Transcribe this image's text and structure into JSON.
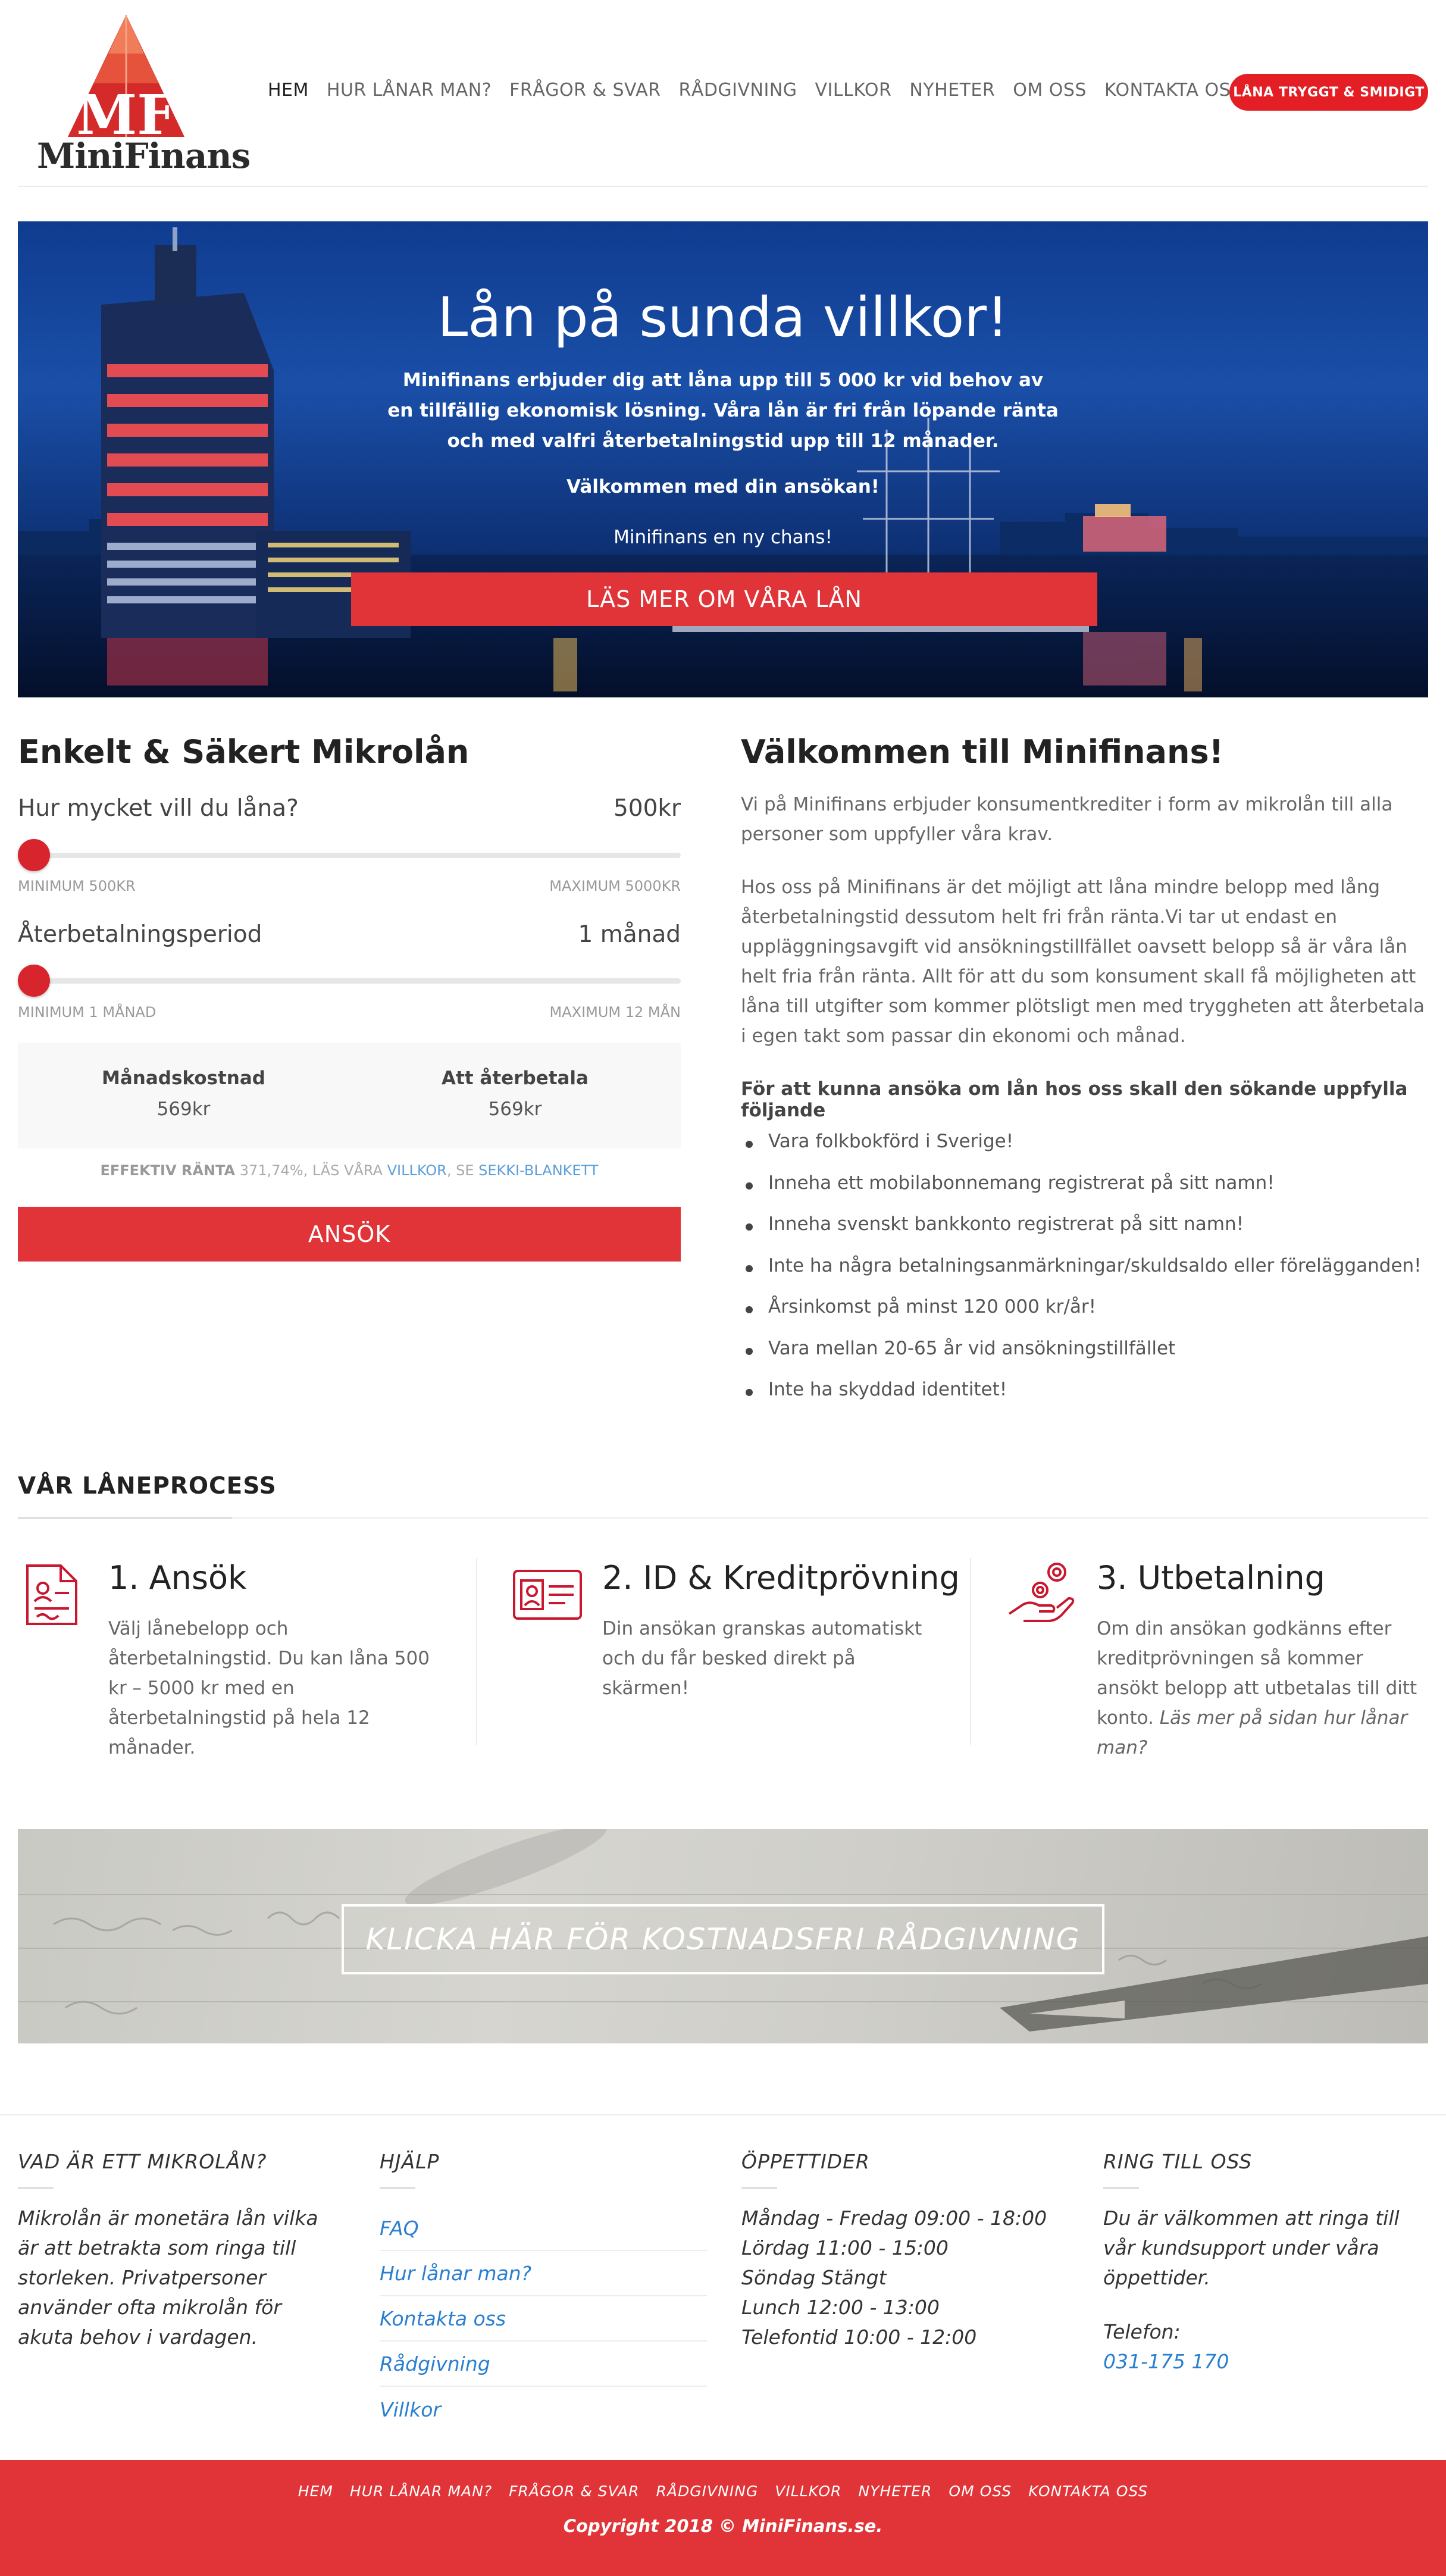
{
  "header": {
    "logo_text": "MiniFinans",
    "logo_monogram": "MF",
    "nav": [
      {
        "label": "HEM",
        "active": true
      },
      {
        "label": "HUR LÅNAR MAN?"
      },
      {
        "label": "FRÅGOR & SVAR"
      },
      {
        "label": "RÅDGIVNING"
      },
      {
        "label": "VILLKOR"
      },
      {
        "label": "NYHETER"
      },
      {
        "label": "OM OSS"
      },
      {
        "label": "KONTAKTA OSS"
      }
    ],
    "cta_label": "LÅNA TRYGGT & SMIDIGT"
  },
  "hero": {
    "title": "Lån på sunda villkor!",
    "text": "Minifinans erbjuder dig att låna upp till 5 000 kr vid behov av en tillfällig ekonomisk lösning. Våra lån är fri från löpande ränta och med valfri återbetalningstid upp till 12 månader.",
    "welcome": "Välkommen med din ansökan!",
    "chance": "Minifinans en ny chans!",
    "button": "LÄS MER OM VÅRA LÅN"
  },
  "calculator": {
    "title": "Enkelt & Säkert Mikrolån",
    "amount_label": "Hur mycket vill du låna?",
    "amount_value": "500kr",
    "amount_min": "MINIMUM 500KR",
    "amount_max": "MAXIMUM 5000KR",
    "amount_fraction": 0.0,
    "period_label": "Återbetalningsperiod",
    "period_value": "1 månad",
    "period_min": "MINIMUM 1 MÅNAD",
    "period_max": "MAXIMUM 12 MÅN",
    "period_fraction": 0.0,
    "monthly_label": "Månadskostnad",
    "monthly_value": "569kr",
    "total_label": "Att återbetala",
    "total_value": "569kr",
    "rate_label": "EFFEKTIV RÄNTA",
    "rate_value": "371,74%, LÄS VÅRA",
    "rate_link1": "VILLKOR",
    "rate_sep": ", SE",
    "rate_link2": "SEKKI-BLANKETT",
    "apply_label": "ANSÖK"
  },
  "welcome": {
    "title": "Välkommen till Minifinans!",
    "p1": "Vi på Minifinans erbjuder konsumentkrediter i form av mikrolån till alla personer som uppfyller våra krav.",
    "p2": "Hos oss på Minifinans är det möjligt att låna mindre belopp med lång återbetalningstid dessutom helt fri från ränta.Vi tar ut endast en uppläggningsavgift vid ansökningstillfället oavsett belopp så är våra lån helt fria från ränta. Allt för att du som konsument skall få möjligheten att låna till utgifter som kommer plötsligt men med tryggheten att återbetala i egen takt som passar din ekonomi och månad.",
    "requirements_title": "För att kunna ansöka om lån hos oss skall den sökande uppfylla följande",
    "requirements": [
      "Vara folkbokförd i Sverige!",
      "Inneha ett mobilabonnemang registrerat på sitt namn!",
      "Inneha svenskt bankkonto registrerat på sitt namn!",
      "Inte ha några betalningsanmärkningar/skuldsaldo eller förelägganden!",
      "Årsinkomst på minst 120 000 kr/år!",
      "Vara mellan 20-65 år vid ansökningstillfället",
      "Inte ha skyddad identitet!"
    ]
  },
  "process": {
    "title": "VÅR LÅNEPROCESS",
    "steps": [
      {
        "title": "1. Ansök",
        "text": "Välj lånebelopp och återbetalningstid. Du kan låna 500 kr – 5000 kr med en återbetalningstid på hela 12 månader.",
        "icon": "document-icon"
      },
      {
        "title": "2. ID & Kreditprövning",
        "text": "Din ansökan granskas automatiskt och du får besked direkt på skärmen!",
        "icon": "id-card-icon"
      },
      {
        "title": "3. Utbetalning",
        "text": "Om din ansökan godkänns efter kreditprövningen så kommer ansökt belopp att utbetalas till ditt konto.",
        "text_em": "Läs mer på sidan hur lånar man?",
        "icon": "hand-coins-icon"
      }
    ]
  },
  "advice": {
    "button": "KLICKA HÄR FÖR KOSTNADSFRI RÅDGIVNING"
  },
  "footer": {
    "col1": {
      "title": "VAD ÄR ETT MIKROLÅN?",
      "text": "Mikrolån är monetära lån vilka är att betrakta som ringa till storleken. Privatpersoner använder ofta mikrolån för akuta behov i vardagen."
    },
    "col2": {
      "title": "HJÄLP",
      "links": [
        "FAQ",
        "Hur lånar man?",
        "Kontakta oss",
        "Rådgivning",
        "Villkor"
      ]
    },
    "col3": {
      "title": "ÖPPETTIDER",
      "lines": [
        "Måndag - Fredag 09:00 - 18:00",
        "Lördag 11:00 - 15:00",
        "Söndag Stängt",
        "Lunch 12:00 - 13:00",
        "Telefontid 10:00 - 12:00"
      ]
    },
    "col4": {
      "title": "RING TILL OSS",
      "text": "Du är välkommen att ringa till vår kundsupport under våra öppettider.",
      "phone_label": "Telefon:",
      "phone": "031-175 170"
    },
    "bottom_nav": [
      "HEM",
      "HUR LÅNAR MAN?",
      "FRÅGOR & SVAR",
      "RÅDGIVNING",
      "VILLKOR",
      "NYHETER",
      "OM OSS",
      "KONTAKTA OSS"
    ],
    "copyright": "Copyright 2018 © MiniFinans.se."
  },
  "colors": {
    "accent": "#e03438",
    "link": "#2a7fd0",
    "hero_sky": "#1a4fa8"
  }
}
